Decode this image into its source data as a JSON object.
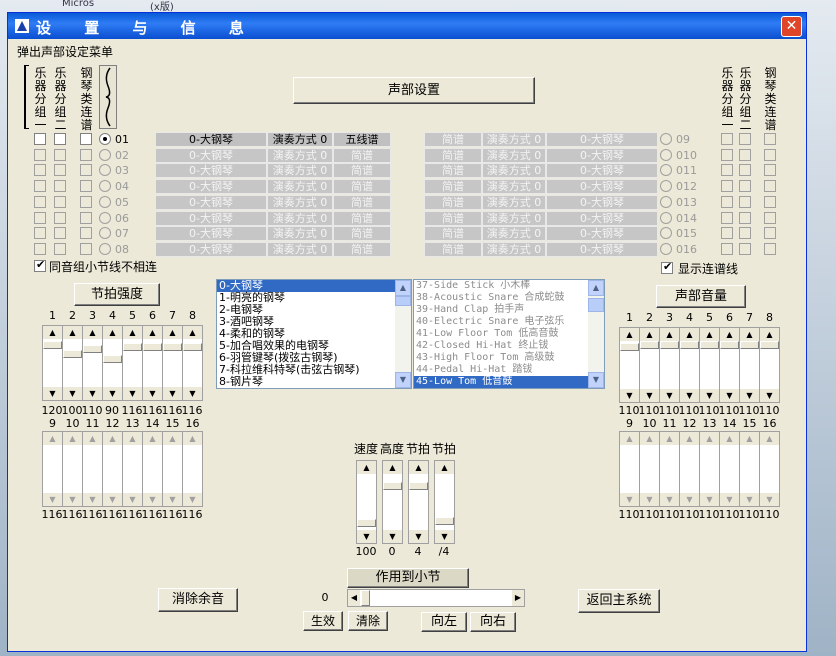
{
  "desktop": {
    "top_text_1": "Micros",
    "top_text_2": "(x版)"
  },
  "window": {
    "title": "设 置 与 信 息",
    "close": "✕"
  },
  "menu": "弹出声部设定菜单",
  "col_headers": {
    "group1": "乐器分组一",
    "group2": "乐器分组二",
    "piano": "钢琴类连谱",
    "group1_r": "乐器分组一",
    "group2_r": "乐器分组二",
    "piano_r": "钢琴类连谱"
  },
  "voice_button": "声部设置",
  "left_rows": [
    {
      "n": "01",
      "inst": "0-大钢琴",
      "mode": "演奏方式 0",
      "staff": "五线谱",
      "active": true
    },
    {
      "n": "02",
      "inst": "0-大钢琴",
      "mode": "演奏方式 0",
      "staff": "简谱",
      "active": false
    },
    {
      "n": "03",
      "inst": "0-大钢琴",
      "mode": "演奏方式 0",
      "staff": "简谱",
      "active": false
    },
    {
      "n": "04",
      "inst": "0-大钢琴",
      "mode": "演奏方式 0",
      "staff": "简谱",
      "active": false
    },
    {
      "n": "05",
      "inst": "0-大钢琴",
      "mode": "演奏方式 0",
      "staff": "简谱",
      "active": false
    },
    {
      "n": "06",
      "inst": "0-大钢琴",
      "mode": "演奏方式 0",
      "staff": "简谱",
      "active": false
    },
    {
      "n": "07",
      "inst": "0-大钢琴",
      "mode": "演奏方式 0",
      "staff": "简谱",
      "active": false
    },
    {
      "n": "08",
      "inst": "0-大钢琴",
      "mode": "演奏方式 0",
      "staff": "简谱",
      "active": false
    }
  ],
  "right_rows": [
    {
      "n": "09",
      "inst": "0-大钢琴",
      "mode": "演奏方式 0",
      "staff": "简谱"
    },
    {
      "n": "010",
      "inst": "0-大钢琴",
      "mode": "演奏方式 0",
      "staff": "简谱"
    },
    {
      "n": "011",
      "inst": "0-大钢琴",
      "mode": "演奏方式 0",
      "staff": "简谱"
    },
    {
      "n": "012",
      "inst": "0-大钢琴",
      "mode": "演奏方式 0",
      "staff": "简谱"
    },
    {
      "n": "013",
      "inst": "0-大钢琴",
      "mode": "演奏方式 0",
      "staff": "简谱"
    },
    {
      "n": "014",
      "inst": "0-大钢琴",
      "mode": "演奏方式 0",
      "staff": "简谱"
    },
    {
      "n": "015",
      "inst": "0-大钢琴",
      "mode": "演奏方式 0",
      "staff": "简谱"
    },
    {
      "n": "016",
      "inst": "0-大钢琴",
      "mode": "演奏方式 0",
      "staff": "简谱"
    }
  ],
  "same_group_label": "同音组小节线不相连",
  "show_tie_label": "显示连谱线",
  "beat_strength": {
    "button": "节拍强度",
    "top_labels": [
      "1",
      "2",
      "3",
      "4",
      "5",
      "6",
      "7",
      "8"
    ],
    "top_values": [
      "120",
      "100",
      "110",
      "90",
      "116",
      "116",
      "116",
      "116"
    ],
    "bottom_labels": [
      "9",
      "10",
      "11",
      "12",
      "13",
      "14",
      "15",
      "16"
    ],
    "bottom_values": [
      "116",
      "116",
      "116",
      "116",
      "116",
      "116",
      "116",
      "116"
    ],
    "top_levels": [
      0.95,
      0.75,
      0.85,
      0.62,
      0.9,
      0.9,
      0.9,
      0.9
    ]
  },
  "instrument_list": [
    "0-大钢琴",
    "1-明亮的钢琴",
    "2-电钢琴",
    "3-酒吧钢琴",
    "4-柔和的钢琴",
    "5-加合唱效果的电钢琴",
    "6-羽管键琴(拨弦古钢琴)",
    "7-科拉维科特琴(击弦古钢琴)",
    "8-钢片琴"
  ],
  "drum_list": [
    "37-Side Stick 小木棒",
    "38-Acoustic Snare 合成蛇鼓",
    "39-Hand Clap 拍手声",
    "40-Electric Snare 电子弦乐",
    "41-Low Floor Tom 低高音鼓",
    "42-Closed Hi-Hat 终止钹",
    "43-High Floor Tom 高级鼓",
    "44-Pedal Hi-Hat 踏钹",
    "45-Low Tom 低音鼓"
  ],
  "voice_volume": {
    "button": "声部音量",
    "top_labels": [
      "1",
      "2",
      "3",
      "4",
      "5",
      "6",
      "7",
      "8"
    ],
    "top_values": [
      "110",
      "110",
      "110",
      "110",
      "110",
      "110",
      "110",
      "110"
    ],
    "bottom_labels": [
      "9",
      "10",
      "11",
      "12",
      "13",
      "14",
      "15",
      "16"
    ],
    "bottom_values": [
      "110",
      "110",
      "110",
      "110",
      "110",
      "110",
      "110",
      "110"
    ]
  },
  "tempo": {
    "labels": [
      "速度",
      "高度",
      "节拍",
      "节拍"
    ],
    "values": [
      "100",
      "0",
      "4",
      "/4"
    ]
  },
  "apply_button": "作用到小节",
  "measure_value": "0",
  "clear_rest_button": "消除余音",
  "effect_button": "生效",
  "clear_button": "清除",
  "left_button": "向左",
  "right_button": "向右",
  "return_button": "返回主系统",
  "colors": {
    "title_blue": "#0a5bd8",
    "selection": "#316ac5",
    "dialog_bg": "#ece9d8"
  }
}
